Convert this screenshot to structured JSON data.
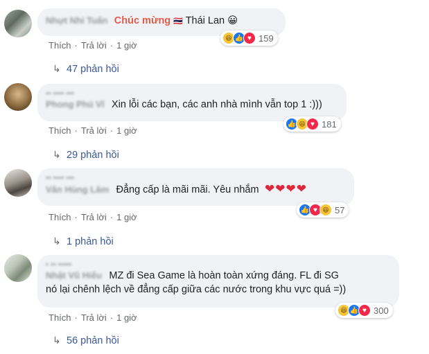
{
  "comments": [
    {
      "name": "Nhựt Nhi Tuấn",
      "text_highlight": "Chúc mừng",
      "flag": "🇹🇭",
      "text": "Thái Lan",
      "emoji": "😀",
      "reaction_count": "159",
      "like": "Thích",
      "reply": "Trả lời",
      "time": "1 giờ",
      "replies": "47 phản hồi"
    },
    {
      "name": "Phong Phú Vĩ",
      "text": "Xin lỗi các bạn, các anh nhà mình vẫn top 1 :)))",
      "reaction_count": "181",
      "like": "Thích",
      "reply": "Trả lời",
      "time": "1 giờ",
      "replies": "29 phản hồi"
    },
    {
      "name": "Vân Hùng Lâm",
      "text": "Đẳng cấp là mãi mãi. Yêu nhắm",
      "hearts": "❤❤❤❤",
      "reaction_count": "57",
      "like": "Thích",
      "reply": "Trả lời",
      "time": "1 giờ",
      "replies": "1 phản hồi"
    },
    {
      "name": "Nhật Vũ Hiếu",
      "text_line1": "MZ đi Sea Game là hoàn toàn xứng đáng. FL đi SG",
      "text_line2": "nó lại chênh lệch về đẳng cấp giữa các nước trong khu vực quá =))",
      "reaction_count": "300",
      "like": "Thích",
      "reply": "Trả lời",
      "time": "1 giờ",
      "replies": "56 phản hồi"
    }
  ],
  "colors": {
    "bubble": "#f0f2f5",
    "link": "#385898",
    "like": "#1877f2",
    "love": "#f0284a",
    "haha": "#f7c53a"
  }
}
